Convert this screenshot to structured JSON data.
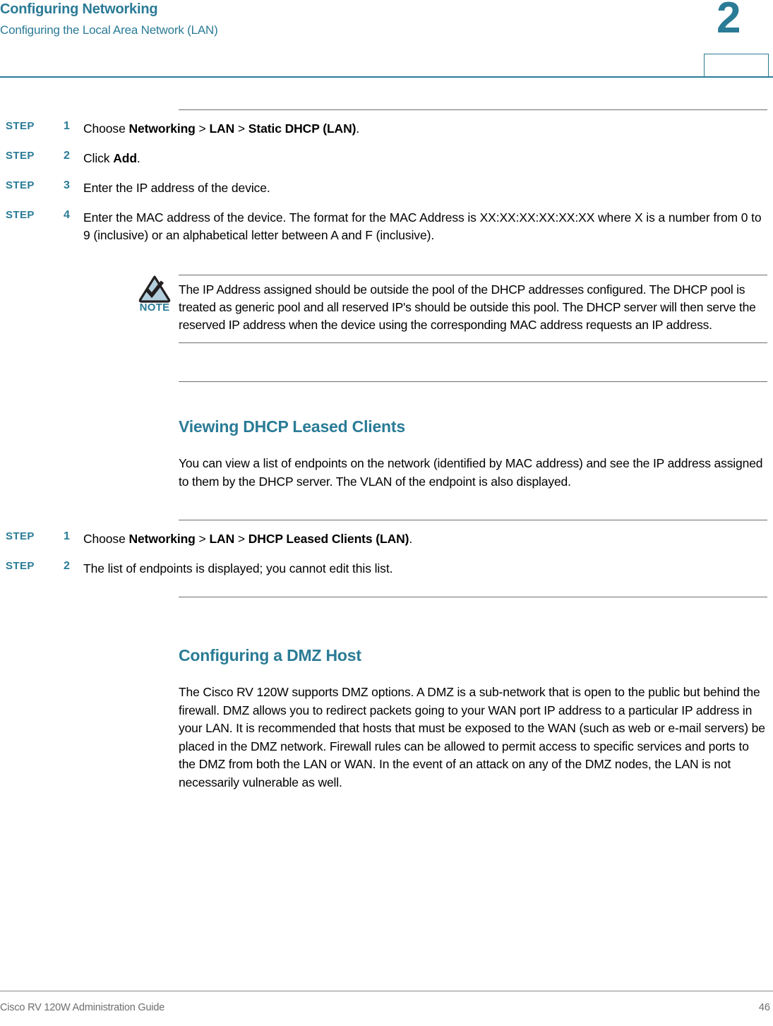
{
  "header": {
    "title": "Configuring Networking",
    "subtitle": "Configuring the Local Area Network (LAN)",
    "chapter": "2"
  },
  "sections": {
    "static_dhcp_steps": [
      {
        "label": "STEP",
        "num": "1",
        "text_pre": "Choose ",
        "bold1": "Networking",
        "sep1": " > ",
        "bold2": "LAN",
        "sep2": " > ",
        "bold3": "Static DHCP (LAN)",
        "text_post": "."
      },
      {
        "label": "STEP",
        "num": "2",
        "text_pre": "Click ",
        "bold1": "Add",
        "text_post": "."
      },
      {
        "label": "STEP",
        "num": "3",
        "text_pre": "Enter the IP address of the device."
      },
      {
        "label": "STEP",
        "num": "4",
        "text_pre": "Enter the MAC address of the device. The format for the MAC Address is XX:XX:XX:XX:XX:XX where X is a number from 0 to 9 (inclusive) or an alphabetical letter between A and F (inclusive)."
      }
    ],
    "note": {
      "icon_label": "NOTE",
      "icon_name": "note-triangle-check-icon",
      "body": "The IP Address assigned should be outside the pool of the DHCP addresses configured. The DHCP pool is treated as generic pool and all reserved IP's should be outside this pool. The DHCP server will then serve the reserved IP address when the device using the corresponding MAC address requests an IP address."
    },
    "viewing_clients": {
      "heading": "Viewing DHCP Leased Clients",
      "paragraph": "You can view a list of endpoints on the network (identified by MAC address) and see the IP address assigned to them by the DHCP server. The VLAN of the endpoint is also displayed.",
      "steps": [
        {
          "label": "STEP",
          "num": "1",
          "text_pre": "Choose ",
          "bold1": "Networking",
          "sep1": " > ",
          "bold2": "LAN",
          "sep2": " > ",
          "bold3": "DHCP Leased Clients (LAN)",
          "text_post": "."
        },
        {
          "label": "STEP",
          "num": "2",
          "text_pre": "The list of endpoints is displayed; you cannot edit this list."
        }
      ]
    },
    "dmz": {
      "heading": "Configuring a DMZ Host",
      "paragraph": "The Cisco RV 120W supports DMZ options. A DMZ is a sub-network that is open to the public but behind the firewall. DMZ allows you to redirect packets going to your WAN port IP address to a particular IP address in your LAN. It is recommended that hosts that must be exposed to the WAN (such as web or e-mail servers) be placed in the DMZ network. Firewall rules can be allowed to permit access to specific services and ports to the DMZ from both the LAN or WAN. In the event of an attack on any of the DMZ nodes, the LAN is not necessarily vulnerable as well."
    }
  },
  "footer": {
    "left": "Cisco RV 120W Administration Guide",
    "page": "46"
  },
  "colors": {
    "accent": "#2a7b96",
    "rule": "#6d6e71",
    "note_fill": "#b3cfdd"
  }
}
